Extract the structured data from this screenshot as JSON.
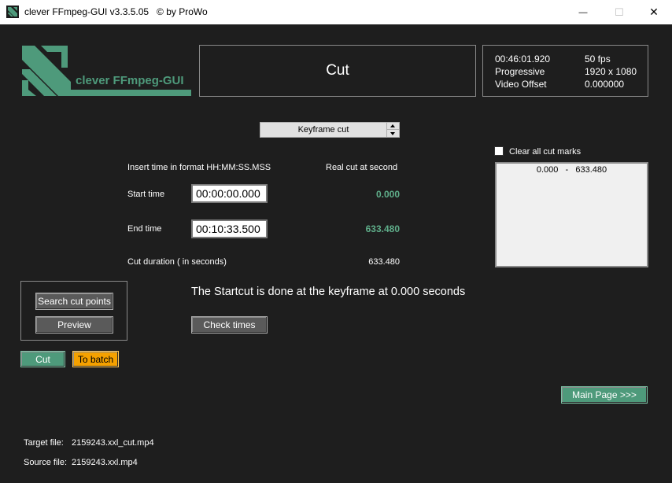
{
  "window": {
    "title": "clever FFmpeg-GUI v3.3.5.05   © by ProWo",
    "minimize": "—",
    "maximize": "☐",
    "close": "✕"
  },
  "logo": {
    "text": "clever FFmpeg-GUI"
  },
  "header": {
    "mode_title": "Cut"
  },
  "video_info": {
    "duration": "00:46:01.920",
    "fps": "50 fps",
    "scan": "Progressive",
    "resolution": "1920 x 1080",
    "offset_label": "Video Offset",
    "offset_value": "0.000000"
  },
  "cut_mode": {
    "selected": "Keyframe cut"
  },
  "labels": {
    "insert_format": "Insert time in format HH:MM:SS.MSS",
    "real_cut": "Real cut at second",
    "start_time": "Start time",
    "end_time": "End time",
    "cut_duration": "Cut duration ( in seconds)"
  },
  "values": {
    "start_time": "00:00:00.000",
    "end_time": "00:10:33.500",
    "real_start": "0.000",
    "real_end": "633.480",
    "duration": "633.480"
  },
  "cut_marks": {
    "clear_label": "Clear all cut marks",
    "items": [
      "0.000   -   633.480"
    ]
  },
  "message": "The Startcut is done at the keyframe at 0.000 seconds",
  "buttons": {
    "search_cut_points": "Search cut points",
    "preview": "Preview",
    "check_times": "Check times",
    "cut": "Cut",
    "to_batch": "To batch",
    "main_page": "Main Page >>>"
  },
  "files": {
    "target_label": "Target file:",
    "target_value": "2159243.xxl_cut.mp4",
    "source_label": "Source file:",
    "source_value": "2159243.xxl.mp4"
  },
  "colors": {
    "accent_green": "#4e9a7b",
    "value_green": "#5fae8a",
    "orange": "#f5a100"
  }
}
